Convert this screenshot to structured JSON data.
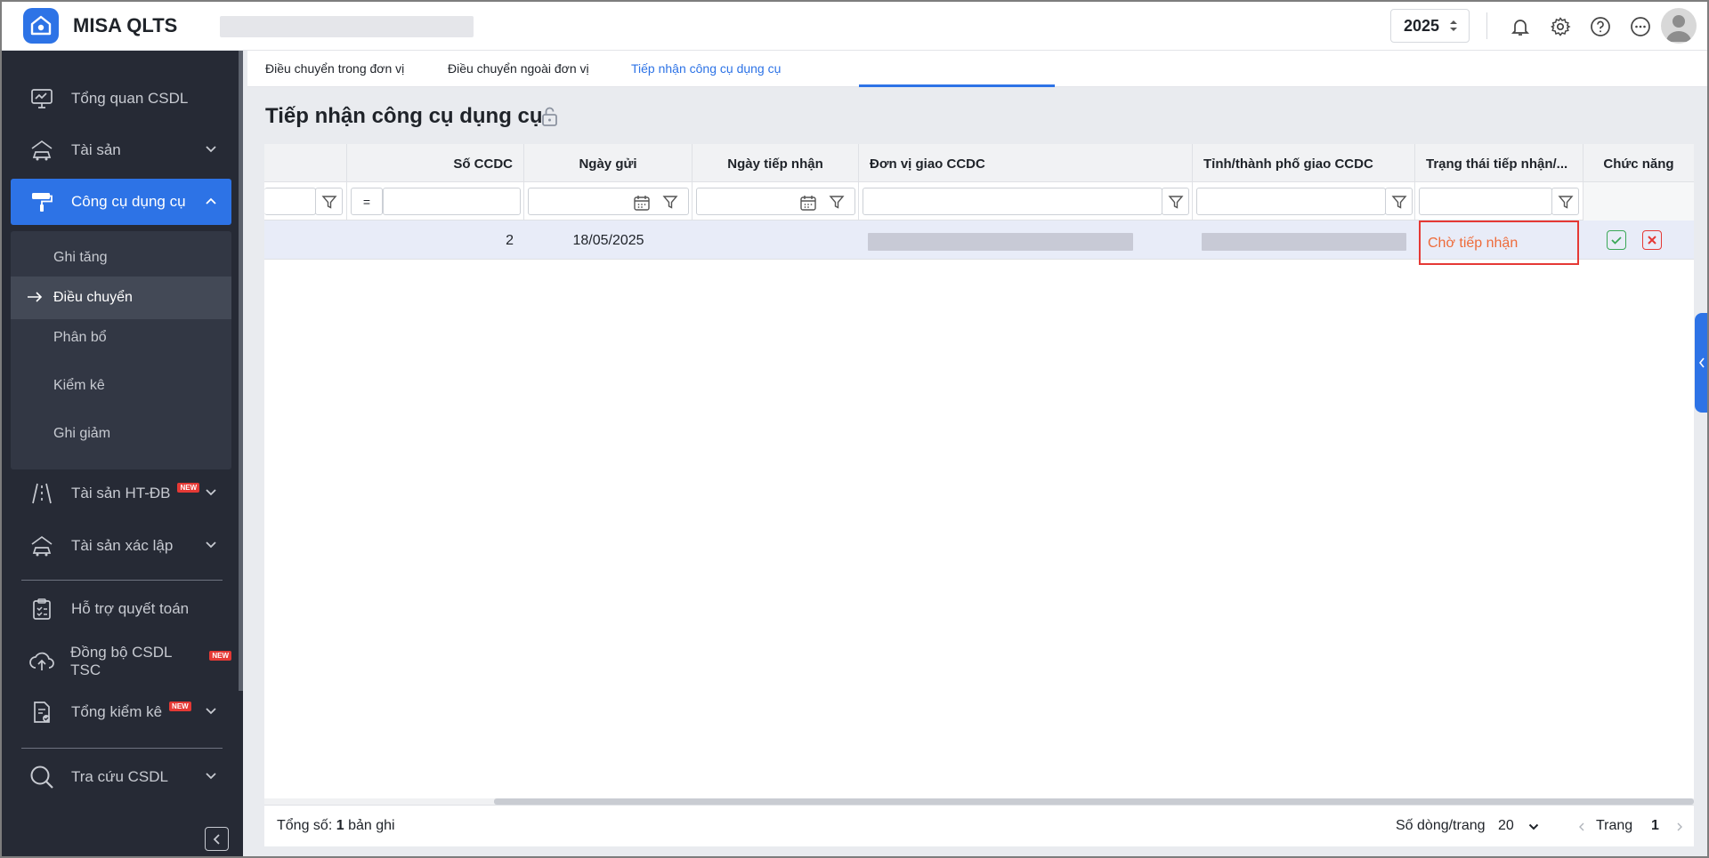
{
  "app": {
    "brand": "MISA QLTS",
    "year": "2025"
  },
  "colors": {
    "accent": "#2d73e6",
    "sidebar_bg": "#262a35",
    "status_warn": "#ee6b3a",
    "highlight": "#e53935",
    "new_badge": "#e53935"
  },
  "topbar": {
    "icons": [
      "bell-icon",
      "gear-icon",
      "help-icon",
      "more-icon",
      "avatar"
    ]
  },
  "sidebar": {
    "items": [
      {
        "label": "Tổng quan CSDL",
        "icon": "monitor-chart-icon"
      },
      {
        "label": "Tài sản",
        "icon": "house-car-icon"
      },
      {
        "label": "Công cụ dụng cụ",
        "icon": "paint-roller-icon"
      },
      {
        "label": "Tài sản HT-ĐB",
        "icon": "road-icon",
        "badge": "NEW"
      },
      {
        "label": "Tài sản xác lập",
        "icon": "house-car-icon"
      },
      {
        "label": "Hỗ trợ quyết toán",
        "icon": "clipboard-check-icon"
      },
      {
        "label": "Đồng bộ CSDL TSC",
        "icon": "cloud-upload-icon",
        "badge": "NEW"
      },
      {
        "label": "Tổng kiểm kê",
        "icon": "document-check-icon",
        "badge": "NEW"
      },
      {
        "label": "Tra cứu CSDL",
        "icon": "search-icon"
      }
    ],
    "submenu": [
      "Ghi tăng",
      "Điều chuyển",
      "Phân bổ",
      "Kiểm kê",
      "Ghi giảm"
    ]
  },
  "tabs": [
    "Điều chuyển trong đơn vị",
    "Điều chuyển ngoài đơn vị",
    "Tiếp nhận công cụ dụng cụ"
  ],
  "page": {
    "title": "Tiếp nhận công cụ dụng cụ"
  },
  "grid": {
    "columns": [
      "Số CCDC",
      "Ngày gửi",
      "Ngày tiếp nhận",
      "Đơn vị giao CCDC",
      "Tỉnh/thành phố giao CCDC",
      "Trạng thái tiếp nhận/...",
      "Chức năng"
    ],
    "filter_operator": "=",
    "rows": [
      {
        "so_ccdc": "2",
        "ngay_gui": "18/05/2025",
        "ngay_tiep_nhan": "",
        "trang_thai": "Chờ tiếp nhận"
      }
    ]
  },
  "footer": {
    "total_label": "Tổng số:",
    "total_count": "1",
    "total_unit": "bản ghi",
    "page_size_label": "Số dòng/trang",
    "page_size": "20",
    "page_label": "Trang",
    "page_number": "1"
  }
}
